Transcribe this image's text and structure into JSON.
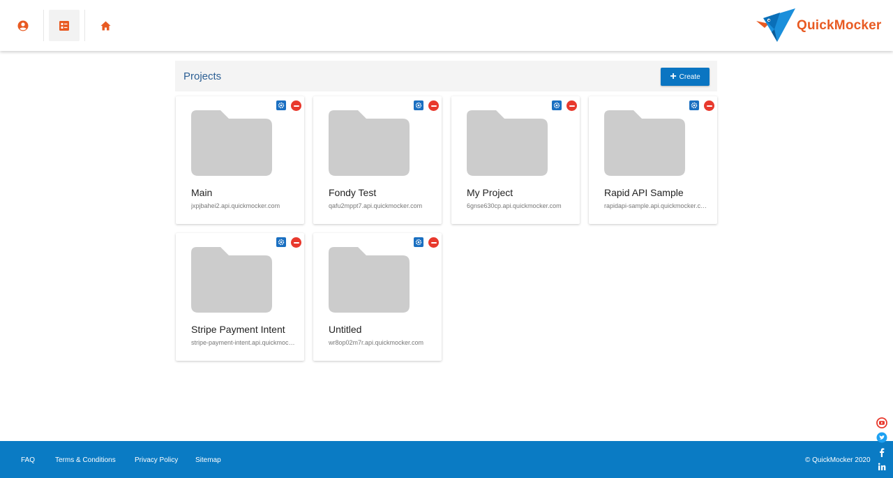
{
  "header": {
    "brand": "QuickMocker",
    "colors": {
      "accent": "#e85a22",
      "brand_blue": "#0a75c2"
    },
    "nav": [
      {
        "icon": "user-circle-icon",
        "active": false
      },
      {
        "icon": "project-list-icon",
        "active": true
      },
      {
        "icon": "home-icon",
        "active": false
      }
    ]
  },
  "projects": {
    "title": "Projects",
    "create_label": "Create",
    "items": [
      {
        "name": "Main",
        "url": "jxpjbahei2.api.quickmocker.com"
      },
      {
        "name": "Fondy Test",
        "url": "qafu2mppt7.api.quickmocker.com"
      },
      {
        "name": "My Project",
        "url": "6gnse630cp.api.quickmocker.com"
      },
      {
        "name": "Rapid API Sample",
        "url": "rapidapi-sample.api.quickmocker.com"
      },
      {
        "name": "Stripe Payment Intent",
        "url": "stripe-payment-intent.api.quickmocker.com"
      },
      {
        "name": "Untitled",
        "url": "wr8op02m7r.api.quickmocker.com"
      }
    ]
  },
  "footer": {
    "links": [
      "FAQ",
      "Terms & Conditions",
      "Privacy Policy",
      "Sitemap"
    ],
    "copyright": "© QuickMocker 2020",
    "background": "#0a7bc4"
  },
  "social": [
    "youtube-icon",
    "twitter-icon",
    "facebook-icon",
    "linkedin-icon"
  ]
}
